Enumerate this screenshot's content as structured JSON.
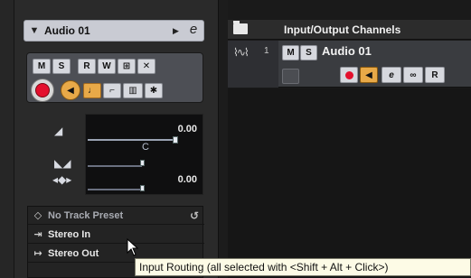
{
  "inspector": {
    "track_name": "Audio 01",
    "buttons_row1": [
      "M",
      "S",
      "R",
      "W"
    ],
    "volume": {
      "value_label": "0.00",
      "level": 0.78
    },
    "pan": {
      "label": "C",
      "value_label": "0.00"
    },
    "presets": {
      "track_preset": "No Track Preset",
      "input_routing": "Stereo In",
      "output_routing": "Stereo Out"
    }
  },
  "track_list": {
    "folder_title": "Input/Output Channels",
    "track": {
      "number": "1",
      "name": "Audio 01",
      "mute_label": "M",
      "solo_label": "S"
    }
  },
  "tooltip": {
    "text": "Input Routing (all selected with <Shift + Alt + Click>)"
  },
  "colors": {
    "record": "#e4102d",
    "monitor": "#e8a948",
    "background": "#1c1c1c"
  }
}
